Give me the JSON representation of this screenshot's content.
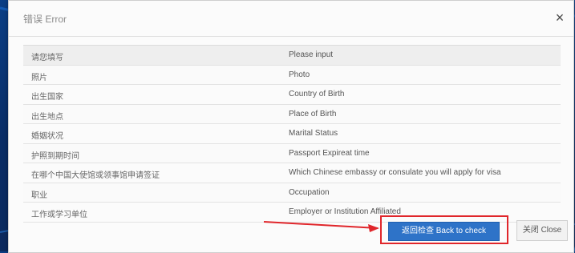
{
  "dialog": {
    "title": "错误 Error",
    "close_icon": "close-icon",
    "rows": [
      {
        "cn": "请您填写",
        "en": "Please input"
      },
      {
        "cn": "照片",
        "en": "Photo"
      },
      {
        "cn": "出生国家",
        "en": "Country of Birth"
      },
      {
        "cn": "出生地点",
        "en": "Place of Birth"
      },
      {
        "cn": "婚姻状况",
        "en": "Marital Status"
      },
      {
        "cn": "护照到期时间",
        "en": "Passport Expireat time"
      },
      {
        "cn": "在哪个中国大使馆或领事馆申请签证",
        "en": "Which Chinese embassy or consulate you will apply for visa"
      },
      {
        "cn": "职业",
        "en": "Occupation"
      },
      {
        "cn": "工作或学习单位",
        "en": "Employer or Institution Affiliated"
      }
    ],
    "back_button_label": "返回检查 Back to check",
    "close_button_label": "关闭 Close"
  },
  "colors": {
    "highlight": "#e0262b",
    "primary": "#2e73c8",
    "background": "#0b3f86"
  }
}
